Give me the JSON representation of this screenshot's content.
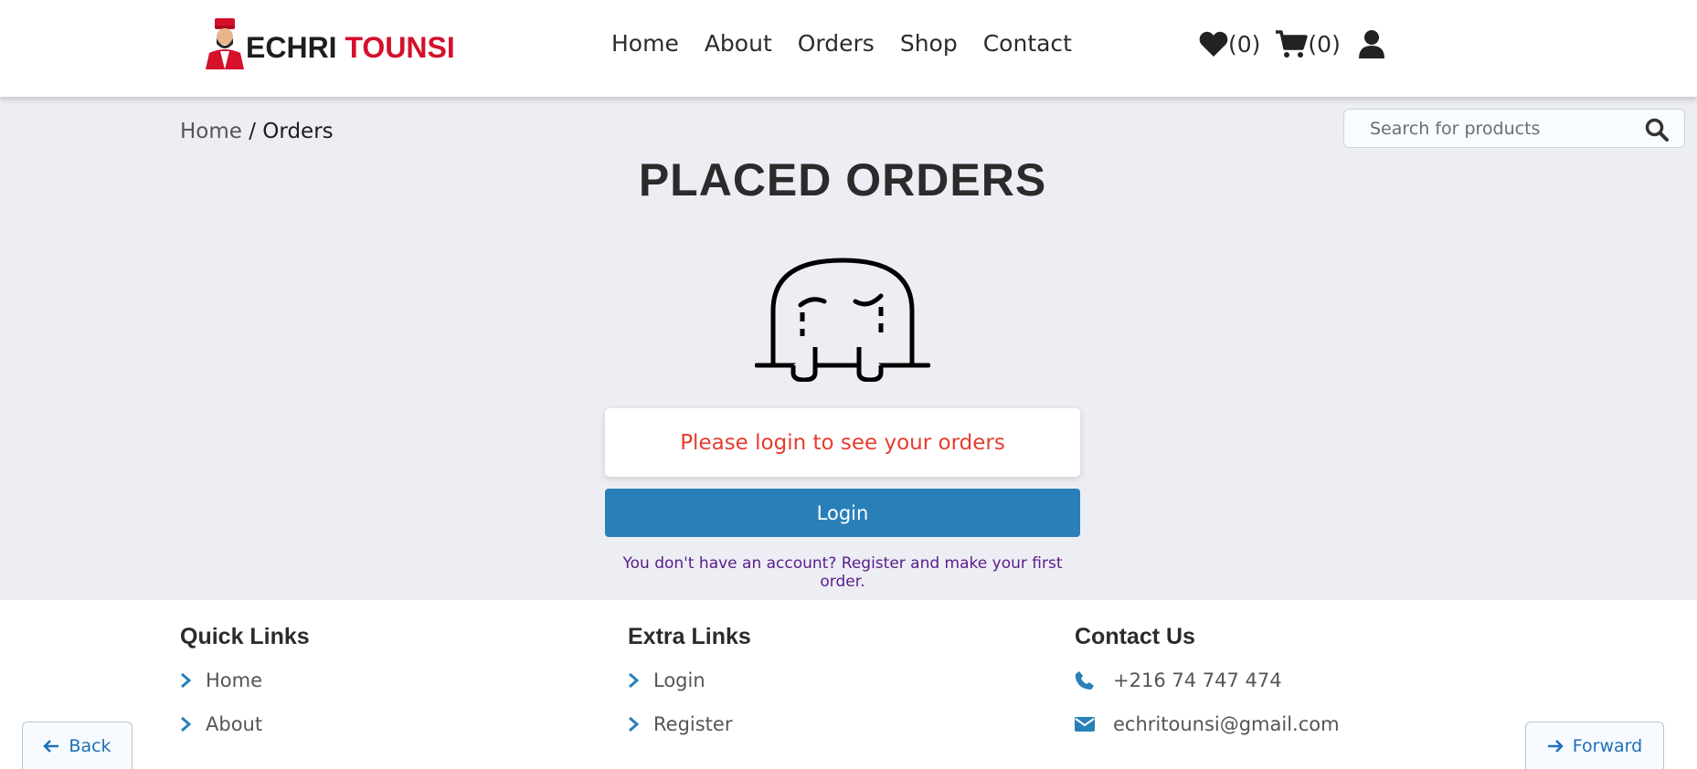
{
  "brand": {
    "part1": "ECHRI ",
    "part2": "TOUNSI"
  },
  "nav": [
    {
      "label": "Home"
    },
    {
      "label": "About"
    },
    {
      "label": "Orders"
    },
    {
      "label": "Shop"
    },
    {
      "label": "Contact"
    }
  ],
  "header_icons": {
    "wishlist_count": "(0)",
    "cart_count": "(0)"
  },
  "breadcrumb": {
    "home": "Home",
    "separator": " / ",
    "current": "Orders"
  },
  "search": {
    "placeholder": "Search for products"
  },
  "page_title": "PLACED ORDERS",
  "empty_state": {
    "message": "Please login to see your orders",
    "login_label": "Login",
    "register_text": "You don't have an account? Register and make your first order."
  },
  "footer": {
    "quick_links": {
      "title": "Quick Links",
      "items": [
        "Home",
        "About"
      ]
    },
    "extra_links": {
      "title": "Extra Links",
      "items": [
        "Login",
        "Register"
      ]
    },
    "contact": {
      "title": "Contact Us",
      "phone": "+216 74 747 474",
      "email": "echritounsi@gmail.com"
    }
  },
  "browser_nav": {
    "back": "Back",
    "forward": "Forward"
  },
  "colors": {
    "accent": "#2980b9",
    "error": "#e53d2f",
    "brand_red": "#d4102a",
    "link_purple": "#5a1b8c"
  }
}
